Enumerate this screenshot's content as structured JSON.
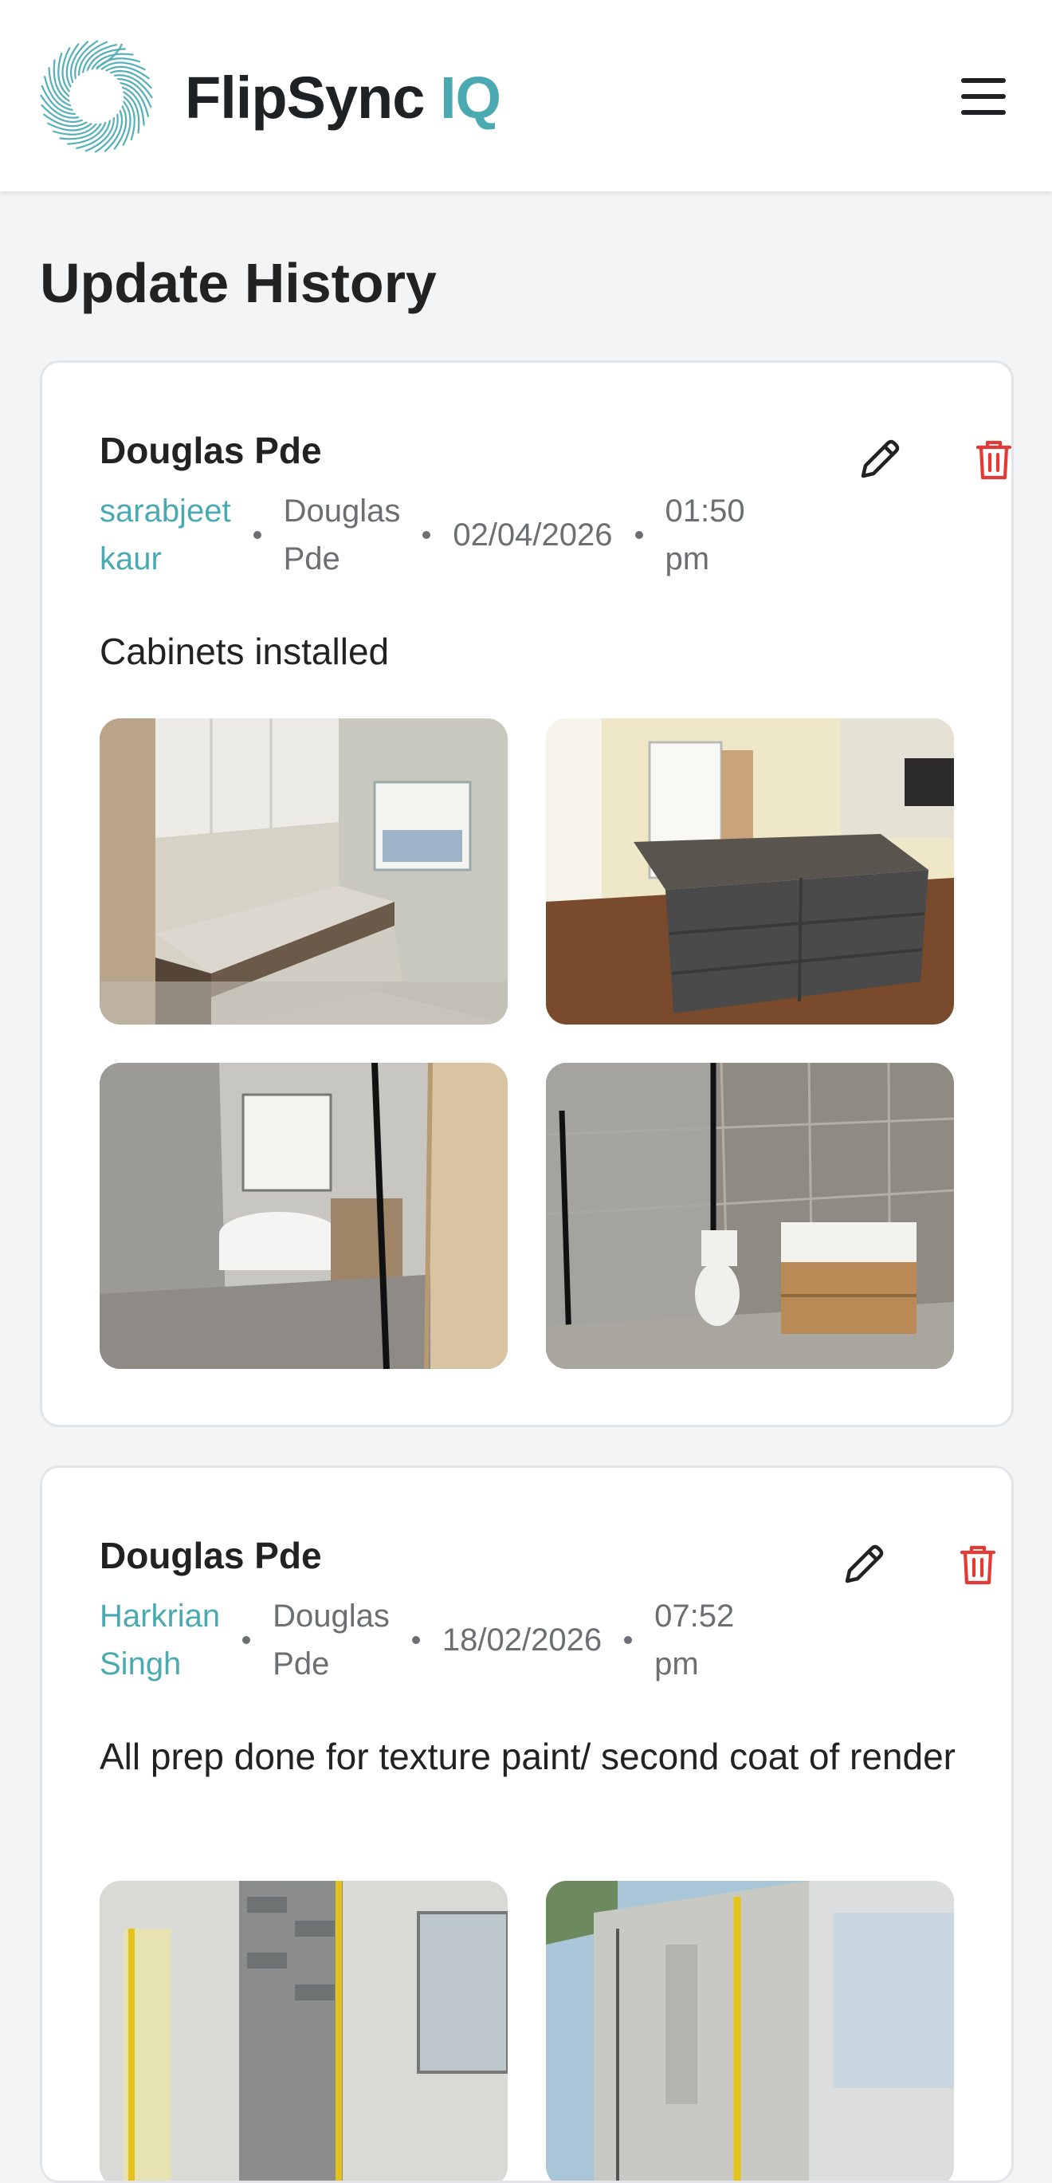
{
  "header": {
    "brand_main": "FlipSync",
    "brand_accent": "IQ",
    "logo_icon": "swirl-logo-icon",
    "menu_icon": "hamburger-menu-icon"
  },
  "page": {
    "title": "Update History"
  },
  "colors": {
    "accent": "#4aa9b1",
    "danger": "#e53935",
    "text": "#222222",
    "muted": "#6b6e72"
  },
  "updates": [
    {
      "site": "Douglas Pde",
      "author_line1": "sarabjeet",
      "author_line2": "kaur",
      "location_line1": "Douglas",
      "location_line2": "Pde",
      "date": "02/04/2026",
      "time_line1": "01:50",
      "time_line2": "pm",
      "note": "Cabinets installed",
      "edit_icon": "pencil-icon",
      "delete_icon": "trash-icon",
      "photos": [
        "laundry-cabinets-photo",
        "kitchen-island-photo",
        "bathroom-bathtub-photo",
        "bathroom-shower-vanity-photo"
      ]
    },
    {
      "site": "Douglas Pde",
      "author_line1": "Harkrian",
      "author_line2": "Singh",
      "location_line1": "Douglas",
      "location_line2": "Pde",
      "date": "18/02/2026",
      "time_line1": "07:52",
      "time_line2": "pm",
      "note": "All prep done for texture paint/ second coat of render",
      "edit_icon": "pencil-icon",
      "delete_icon": "trash-icon",
      "photos": [
        "exterior-wall-masking-photo",
        "exterior-side-wall-photo"
      ]
    }
  ]
}
